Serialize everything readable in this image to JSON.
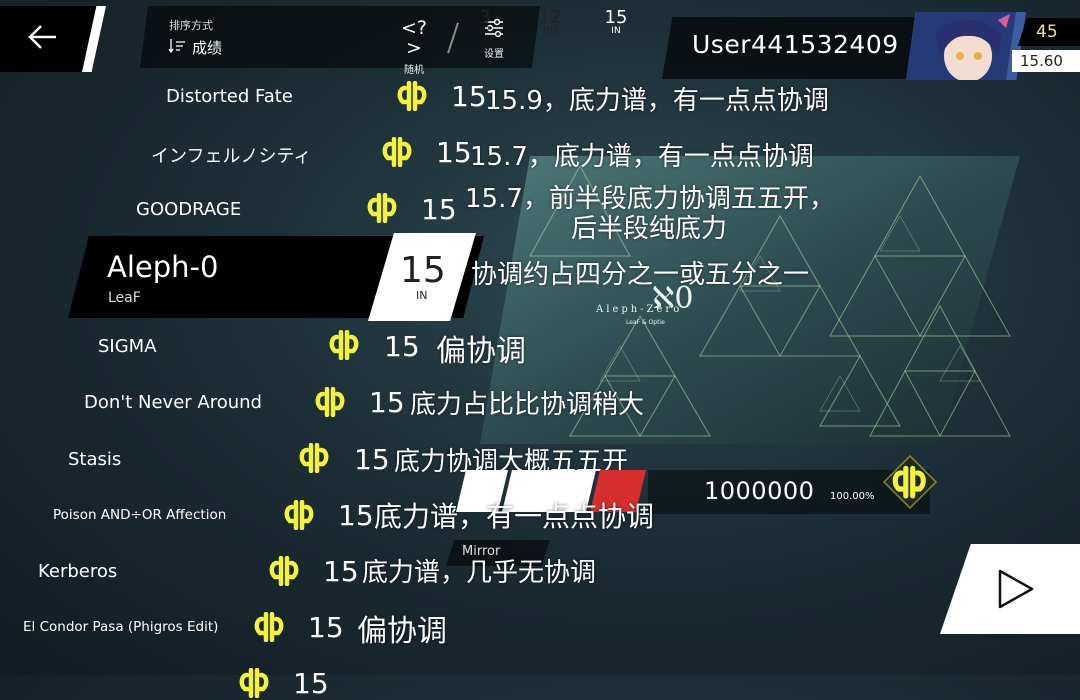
{
  "header": {
    "sort_caption": "排序方式",
    "sort_value": "成绩",
    "random_label": "随机",
    "settings_label": "设置"
  },
  "user": {
    "name": "User441532409",
    "level": "45",
    "rks": "15.60"
  },
  "songs": [
    {
      "title": "Distorted Fate",
      "level": "15",
      "comment": "15.9，底力谱，有一点点协调"
    },
    {
      "title": "インフェルノシティ",
      "level": "15",
      "comment": "15.7，底力谱，有一点点协调"
    },
    {
      "title": "GOODRAGE",
      "level": "15",
      "comment_line1": "15.7，前半段底力协调五五开，",
      "comment_line2": "后半段纯底力"
    },
    {
      "title": "SIGMA",
      "level": "15",
      "comment": "偏协调"
    },
    {
      "title": "Don't Never Around",
      "level": "15",
      "comment": "底力占比比协调稍大"
    },
    {
      "title": "Stasis",
      "level": "15",
      "comment": "底力协调大概五五开"
    },
    {
      "title": "Poison AND÷OR Affection",
      "level": "15",
      "comment": "底力谱，有一点点协调"
    },
    {
      "title": "Kerberos",
      "level": "15",
      "comment": "底力谱，几乎无协调"
    },
    {
      "title": "El Condor Pasa (Phigros Edit)",
      "level": "15",
      "comment": "偏协调"
    },
    {
      "title": "",
      "level": "15",
      "comment": ""
    }
  ],
  "selected_song": {
    "title": "Aleph-0",
    "artist": "LeaF",
    "level": "15",
    "difficulty": "IN",
    "comment": "协调约占四分之一或五分之一"
  },
  "illustration": {
    "logo_text": "Aleph-Zero",
    "logo_sub": "LeaF & Optie",
    "logo_glyph": "ℵ0"
  },
  "difficulties": [
    {
      "value": "3",
      "label": "EZ"
    },
    {
      "value": "12",
      "label": "HD"
    },
    {
      "value": "15",
      "label": "IN"
    }
  ],
  "score": {
    "value": "1000000",
    "accuracy": "100.00%"
  },
  "mirror_label": "Mirror",
  "colors": {
    "accent_red": "#d62e2e",
    "phi_yellow": "#f4f23c",
    "level_yellow": "#f2e66e"
  },
  "icons": {
    "back": "back-arrow-icon",
    "sort": "sort-icon",
    "random": "random-icon",
    "settings": "settings-icon",
    "phi": "phi-rank-icon",
    "play": "play-icon"
  }
}
